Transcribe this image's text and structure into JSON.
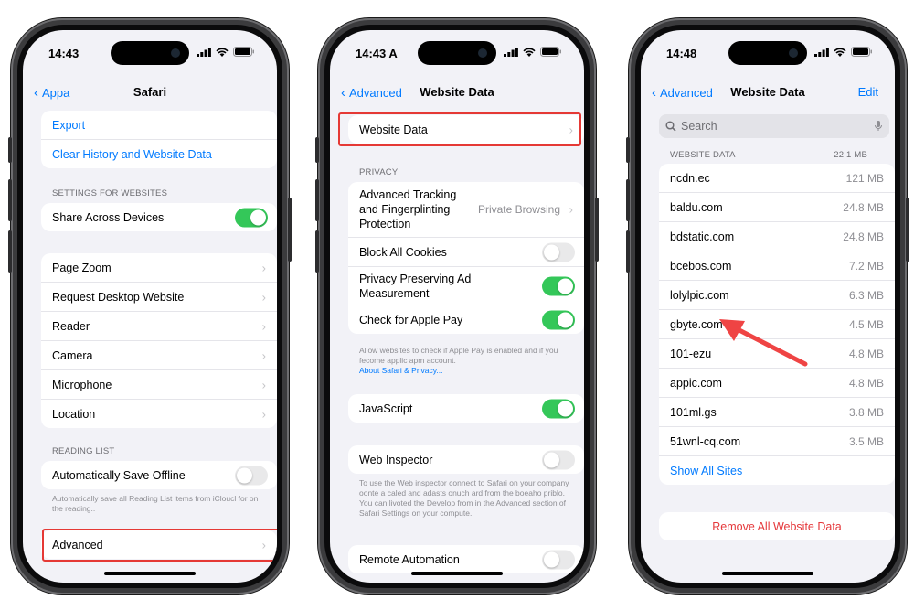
{
  "phones": [
    {
      "status": {
        "time": "14:43"
      },
      "nav": {
        "back": "Appa",
        "title": "Safari"
      },
      "top_group": [
        "Export",
        "Clear History and Website Data"
      ],
      "settings_header": "SETTINGS FOR WEBSITES",
      "share_row": {
        "label": "Share Across Devices",
        "on": true
      },
      "list_group": [
        "Page Zoom",
        "Request Desktop Website",
        "Reader",
        "Camera",
        "Microphone",
        "Location"
      ],
      "reading_header": "READING LIST",
      "save_offline": {
        "label": "Automatically Save Offline",
        "on": false
      },
      "reading_footnote": "Automatically save all Reading List items from iCloucl for on the reading..",
      "advanced": "Advanced"
    },
    {
      "status": {
        "time": "14:43 A"
      },
      "nav": {
        "back": "Advanced",
        "title": "Website Data"
      },
      "website_data_row": "Website Data",
      "privacy_header": "PRIVACY",
      "tracking": {
        "label_lines": [
          "Advanced Tracking",
          "and Fingerplinting",
          "Protection"
        ],
        "value": "Private Browsing"
      },
      "block_cookies": {
        "label": "Block All Cookies",
        "on": false
      },
      "privacy_ad": {
        "label_lines": [
          "Privacy Preserving Ad",
          "Measurement"
        ],
        "on": true
      },
      "apple_pay": {
        "label": "Check for Apple Pay",
        "on": true
      },
      "apple_pay_footnote": "Allow websites to check if Apple Pay is enabled and if you fecome applic apm account.",
      "about_link": "About Safari & Privacy...",
      "javascript": {
        "label": "JavaScript",
        "on": true
      },
      "web_inspector": {
        "label": "Web Inspector",
        "on": false
      },
      "inspector_footnote": "To use the Web inspector connect to Safari on your company oonte a caled and adasts onuch ard from the boeaho priblo. You can livoted the Develop from in the Advanced section of Safari Settings on your compute.",
      "remote_automation": {
        "label": "Remote Automation",
        "on": false
      }
    },
    {
      "status": {
        "time": "14:48"
      },
      "nav": {
        "back": "Advanced",
        "title": "Website Data",
        "edit": "Edit"
      },
      "search": {
        "placeholder": "Search"
      },
      "section": {
        "label": "WEBSITE DATA",
        "total": "22.1 MB"
      },
      "sites": [
        {
          "name": "ncdn.ec",
          "size": "121 MB"
        },
        {
          "name": "baldu.com",
          "size": "24.8 MB"
        },
        {
          "name": "bdstatic.com",
          "size": "24.8 MB"
        },
        {
          "name": "bcebos.com",
          "size": "7.2 MB"
        },
        {
          "name": "lolylpic.com",
          "size": "6.3 MB"
        },
        {
          "name": "gbyte.com",
          "size": "4.5 MB"
        },
        {
          "name": "101-ezu",
          "size": "4.8 MB"
        },
        {
          "name": "appic.com",
          "size": "4.8 MB"
        },
        {
          "name": "101ml.gs",
          "size": "3.8 MB"
        },
        {
          "name": "51wnl-cq.com",
          "size": "3.5 MB"
        }
      ],
      "show_all": "Show All Sites",
      "remove_all": "Remove All Website Data"
    }
  ],
  "colors": {
    "accent": "#007aff",
    "toggle_on": "#34c759",
    "highlight": "#e53935",
    "destructive": "#e5383b"
  }
}
